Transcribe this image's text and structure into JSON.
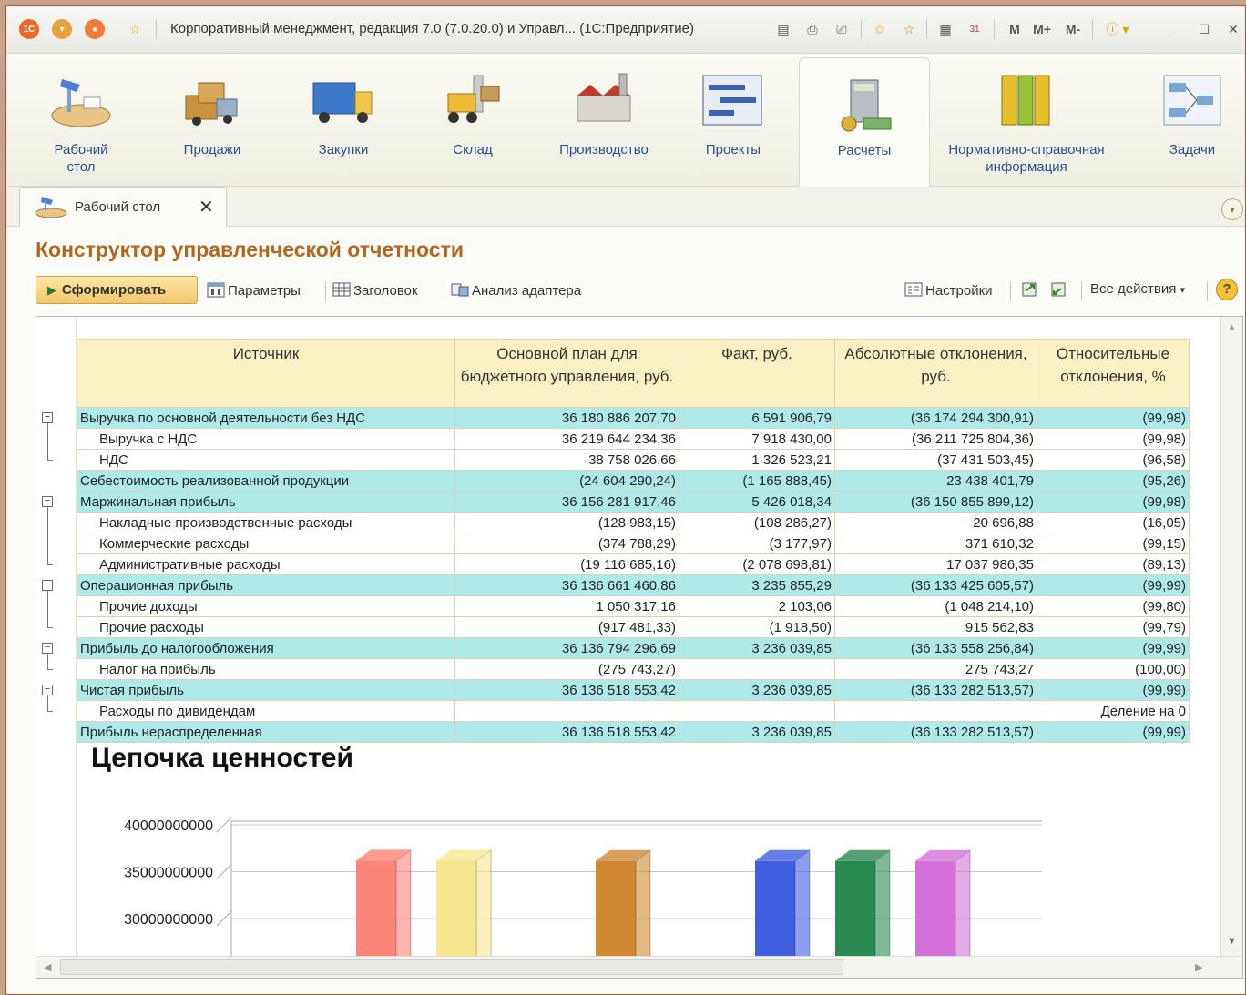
{
  "window": {
    "title": "Корпоративный менеджмент, редакция 7.0 (7.0.20.0) и Управл...  (1С:Предприятие)",
    "memory_buttons": [
      "M",
      "M+",
      "M-"
    ]
  },
  "sections": [
    {
      "label": "Рабочий\nстол",
      "icon": "desk-icon"
    },
    {
      "label": "Продажи",
      "icon": "truck-boxes-icon"
    },
    {
      "label": "Закупки",
      "icon": "lorry-icon"
    },
    {
      "label": "Склад",
      "icon": "forklift-icon"
    },
    {
      "label": "Производство",
      "icon": "factory-icon"
    },
    {
      "label": "Проекты",
      "icon": "gantt-icon"
    },
    {
      "label": "Расчеты",
      "icon": "calculator-icon"
    },
    {
      "label": "Нормативно-справочная\nинформация",
      "icon": "binders-icon"
    },
    {
      "label": "Задачи",
      "icon": "flowchart-icon"
    }
  ],
  "doc_tab": {
    "label": "Рабочий стол",
    "close": "✕"
  },
  "page": {
    "title": "Конструктор управленческой отчетности",
    "buttons": {
      "generate": "Сформировать",
      "parameters": "Параметры",
      "header": "Заголовок",
      "adapter": "Анализ адаптера",
      "settings": "Настройки",
      "all_actions": "Все действия",
      "help": "?"
    }
  },
  "report": {
    "columns": [
      "Источник",
      "Основной план для бюджетного управления, руб.",
      "Факт, руб.",
      "Абсолютные отклонения, руб.",
      "Относительные отклонения, %"
    ],
    "rows": [
      {
        "level": 1,
        "name": "Выручка по основной деятельности без НДС",
        "plan": "36 180 886 207,70",
        "fact": "6 591 906,79",
        "abs": "(36 174 294 300,91)",
        "rel": "(99,98)"
      },
      {
        "level": 2,
        "name": "Выручка с НДС",
        "plan": "36 219 644 234,36",
        "fact": "7 918 430,00",
        "abs": "(36 211 725 804,36)",
        "rel": "(99,98)"
      },
      {
        "level": 2,
        "name": "НДС",
        "plan": "38 758 026,66",
        "fact": "1 326 523,21",
        "abs": "(37 431 503,45)",
        "rel": "(96,58)"
      },
      {
        "level": 1,
        "name": "Себестоимость реализованной продукции",
        "plan": "(24 604 290,24)",
        "fact": "(1 165 888,45)",
        "abs": "23 438 401,79",
        "rel": "(95,26)"
      },
      {
        "level": 1,
        "name": "Маржинальная прибыль",
        "plan": "36 156 281 917,46",
        "fact": "5 426 018,34",
        "abs": "(36 150 855 899,12)",
        "rel": "(99,98)"
      },
      {
        "level": 2,
        "name": "Накладные производственные расходы",
        "plan": "(128 983,15)",
        "fact": "(108 286,27)",
        "abs": "20 696,88",
        "rel": "(16,05)"
      },
      {
        "level": 2,
        "name": "Коммерческие расходы",
        "plan": "(374 788,29)",
        "fact": "(3 177,97)",
        "abs": "371 610,32",
        "rel": "(99,15)"
      },
      {
        "level": 2,
        "name": "Административные расходы",
        "plan": "(19 116 685,16)",
        "fact": "(2 078 698,81)",
        "abs": "17 037 986,35",
        "rel": "(89,13)"
      },
      {
        "level": 1,
        "name": "Операционная прибыль",
        "plan": "36 136 661 460,86",
        "fact": "3 235 855,29",
        "abs": "(36 133 425 605,57)",
        "rel": "(99,99)"
      },
      {
        "level": 2,
        "name": "Прочие доходы",
        "plan": "1 050 317,16",
        "fact": "2 103,06",
        "abs": "(1 048 214,10)",
        "rel": "(99,80)"
      },
      {
        "level": 2,
        "name": "Прочие расходы",
        "plan": "(917 481,33)",
        "fact": "(1 918,50)",
        "abs": "915 562,83",
        "rel": "(99,79)"
      },
      {
        "level": 1,
        "name": "Прибыль до налогообложения",
        "plan": "36 136 794 296,69",
        "fact": "3 236 039,85",
        "abs": "(36 133 558 256,84)",
        "rel": "(99,99)"
      },
      {
        "level": 2,
        "name": "Налог на прибыль",
        "plan": "(275 743,27)",
        "fact": "",
        "abs": "275 743,27",
        "rel": "(100,00)"
      },
      {
        "level": 1,
        "name": "Чистая прибыль",
        "plan": "36 136 518 553,42",
        "fact": "3 236 039,85",
        "abs": "(36 133 282 513,57)",
        "rel": "(99,99)"
      },
      {
        "level": 2,
        "name": "Расходы по дивидендам",
        "plan": "",
        "fact": "",
        "abs": "",
        "rel": "Деление на 0"
      },
      {
        "level": 1,
        "name": "Прибыль нераспределенная",
        "plan": "36 136 518 553,42",
        "fact": "3 236 039,85",
        "abs": "(36 133 282 513,57)",
        "rel": "(99,99)"
      }
    ]
  },
  "chart_data": {
    "type": "bar",
    "title": "Цепочка ценностей",
    "yticks": [
      "40000000000",
      "35000000000",
      "30000000000"
    ],
    "ylim": [
      28000000000,
      40000000000
    ],
    "values": [
      36180886207.7,
      36156281917.46,
      36136661460.86,
      36136794296.69,
      36136518553.42,
      36136518553.42
    ],
    "colors": [
      "#fb8577",
      "#f6e690",
      "#d08833",
      "#3f5fe0",
      "#2a8a4f",
      "#d370d8"
    ],
    "gap_after": [
      1,
      2
    ]
  }
}
